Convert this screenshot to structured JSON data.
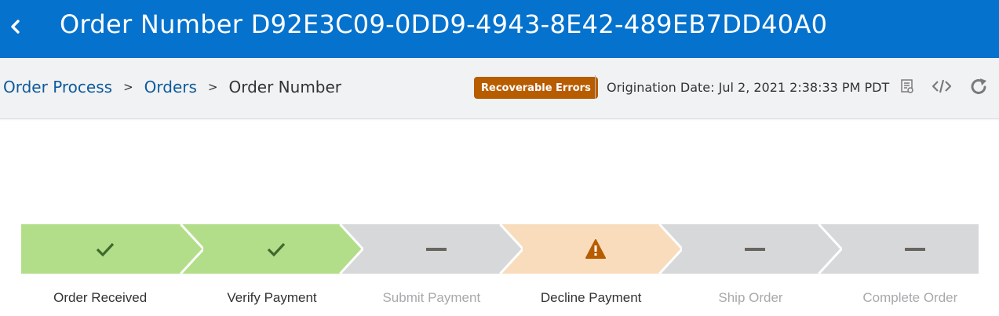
{
  "header": {
    "title": "Order Number D92E3C09-0DD9-4943-8E42-489EB7DD40A0",
    "back_icon": "chevron-left-icon"
  },
  "breadcrumb": {
    "items": [
      "Order Process",
      "Orders"
    ],
    "separator": ">",
    "current": "Order Number"
  },
  "status_badge": "Recoverable Errors",
  "origination_date": "Origination Date: Jul 2, 2021 2:38:33 PM PDT",
  "toolbar_icons": [
    "details-icon",
    "code-icon",
    "refresh-icon"
  ],
  "colors": {
    "header_bg": "#0572ce",
    "badge_bg": "#b85c00",
    "complete": "#b2de89",
    "pending": "#d6d8da",
    "warning": "#f8dcbc",
    "check": "#3d6a2c",
    "dash": "#6b6560",
    "warn_icon": "#b85c00"
  },
  "steps": [
    {
      "label": "Order Received",
      "status": "complete",
      "icon": "checkmark-icon"
    },
    {
      "label": "Verify Payment",
      "status": "complete",
      "icon": "checkmark-icon"
    },
    {
      "label": "Submit Payment",
      "status": "pending",
      "icon": "dash-icon"
    },
    {
      "label": "Decline Payment",
      "status": "warning",
      "icon": "warning-triangle-icon"
    },
    {
      "label": "Ship Order",
      "status": "pending",
      "icon": "dash-icon"
    },
    {
      "label": "Complete Order",
      "status": "pending",
      "icon": "dash-icon"
    }
  ]
}
